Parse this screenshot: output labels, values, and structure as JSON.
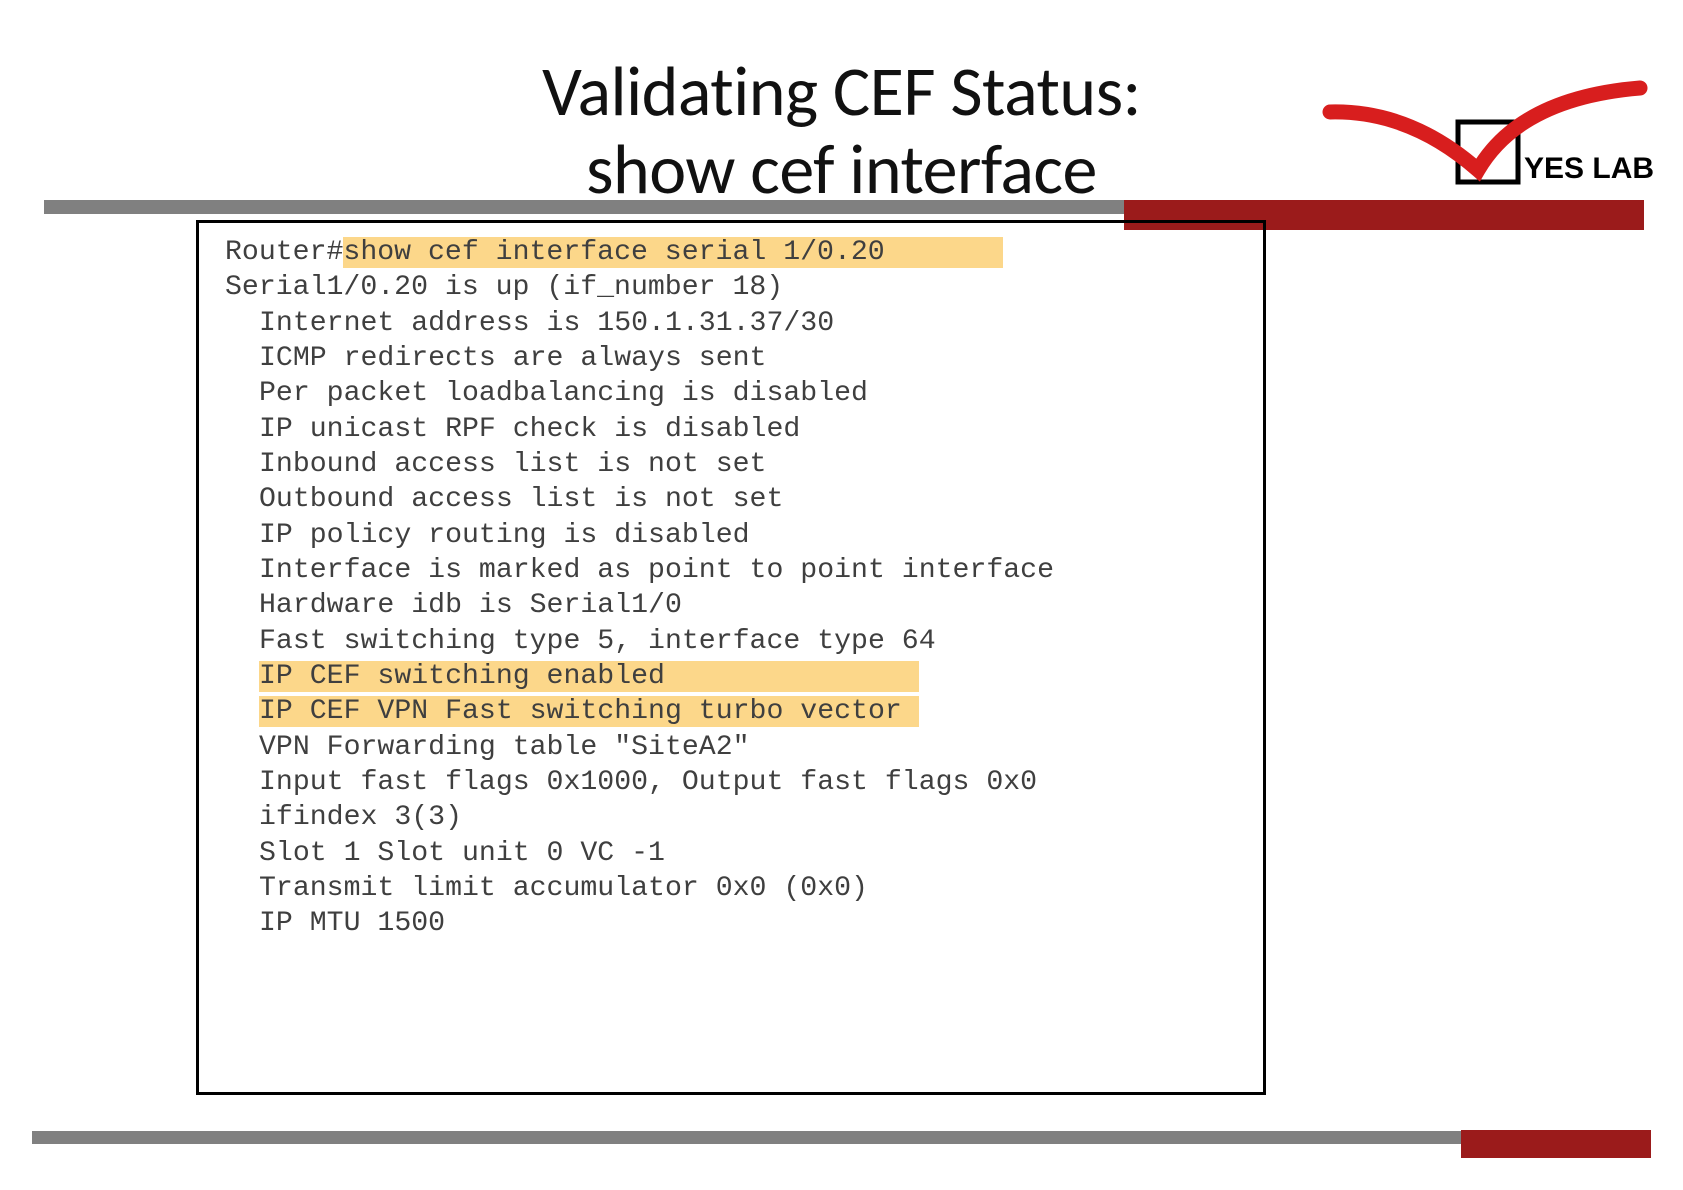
{
  "title": {
    "line1": "Validating CEF Status:",
    "line2": "show cef interface"
  },
  "logo": {
    "brand_text": "YES LAB"
  },
  "terminal": {
    "prompt": "Router#",
    "command": "show cef interface serial 1/0.20",
    "lines": [
      "Serial1/0.20 is up (if_number 18)",
      "Internet address is 150.1.31.37/30",
      "ICMP redirects are always sent",
      "Per packet loadbalancing is disabled",
      "IP unicast RPF check is disabled",
      "Inbound access list is not set",
      "Outbound access list is not set",
      "IP policy routing is disabled",
      "Interface is marked as point to point interface",
      "Hardware idb is Serial1/0",
      "Fast switching type 5, interface type 64",
      "IP CEF switching enabled",
      "IP CEF VPN Fast switching turbo vector",
      "VPN Forwarding table \"SiteA2\"",
      "Input fast flags 0x1000, Output fast flags 0x0",
      "ifindex 3(3)",
      "Slot 1 Slot unit 0 VC -1",
      "Transmit limit accumulator 0x0 (0x0)",
      "IP MTU 1500"
    ],
    "highlight_indices": [
      11,
      12
    ]
  }
}
